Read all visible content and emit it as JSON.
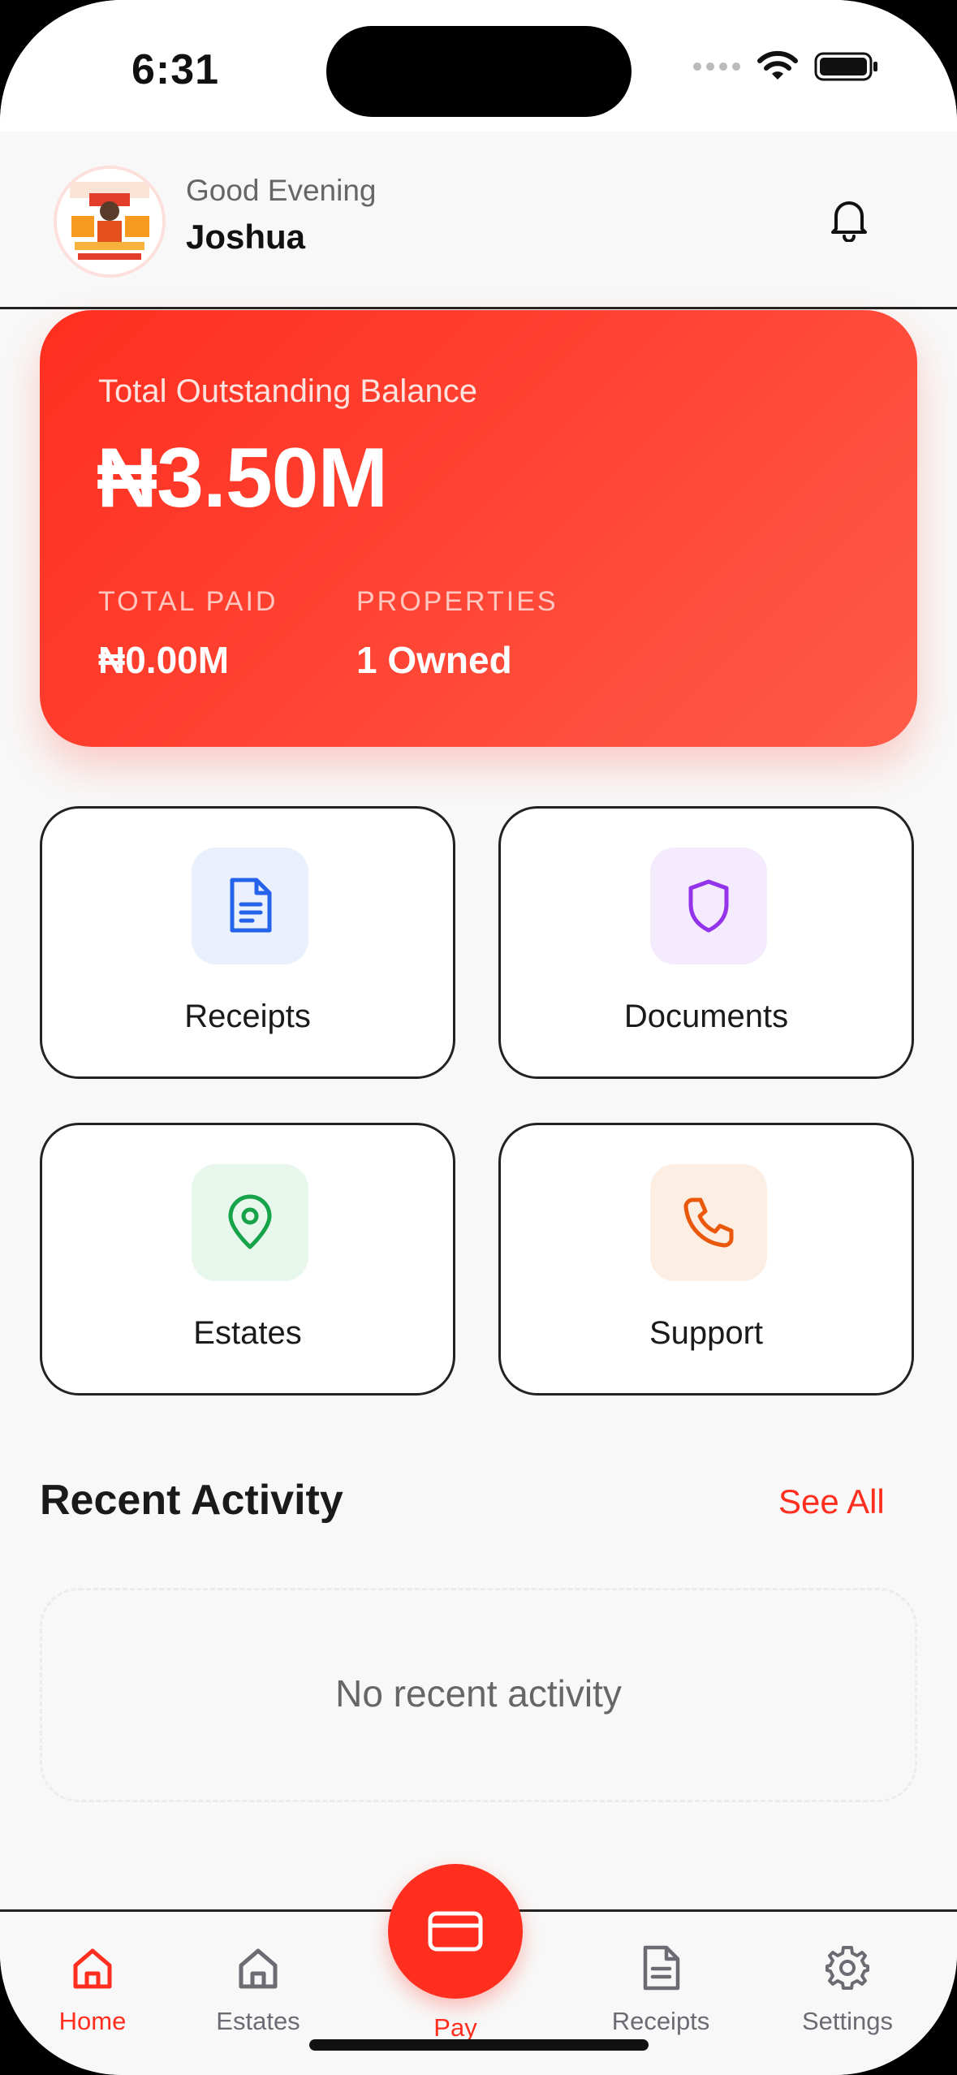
{
  "status_bar": {
    "time": "6:31"
  },
  "header": {
    "greeting": "Good Evening",
    "username": "Joshua"
  },
  "balance_card": {
    "label": "Total Outstanding Balance",
    "amount": "₦3.50M",
    "total_paid_label": "TOTAL PAID",
    "total_paid_value": "₦0.00M",
    "properties_label": "PROPERTIES",
    "properties_value": "1 Owned"
  },
  "quick_actions": [
    {
      "label": "Receipts",
      "icon": "document-icon",
      "color": "#2563eb",
      "bg": "#eaf1fd"
    },
    {
      "label": "Documents",
      "icon": "shield-icon",
      "color": "#9333ea",
      "bg": "#f4ecfd"
    },
    {
      "label": "Estates",
      "icon": "location-pin-icon",
      "color": "#16a34a",
      "bg": "#e7f7ec"
    },
    {
      "label": "Support",
      "icon": "phone-icon",
      "color": "#ea580c",
      "bg": "#fdeee4"
    }
  ],
  "recent_activity": {
    "title": "Recent Activity",
    "see_all": "See All",
    "empty_text": "No recent activity"
  },
  "tab_bar": {
    "active": "Home",
    "tabs": [
      {
        "label": "Home",
        "icon": "home-icon"
      },
      {
        "label": "Estates",
        "icon": "building-icon"
      },
      {
        "label": "Pay",
        "icon": "card-icon"
      },
      {
        "label": "Receipts",
        "icon": "document-icon"
      },
      {
        "label": "Settings",
        "icon": "gear-icon"
      }
    ]
  },
  "colors": {
    "accent": "#ff2e1f"
  }
}
